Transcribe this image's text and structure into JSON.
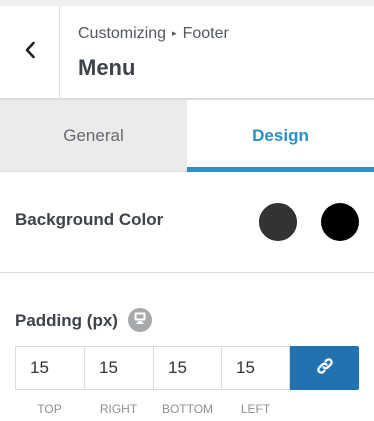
{
  "header": {
    "breadcrumb": {
      "root": "Customizing",
      "section": "Footer"
    },
    "title": "Menu",
    "back_icon": "chevron-left-icon"
  },
  "tabs": [
    {
      "label": "General",
      "active": false
    },
    {
      "label": "Design",
      "active": true
    }
  ],
  "background_color": {
    "label": "Background Color",
    "swatches": [
      {
        "name": "primary",
        "color": "#333333"
      },
      {
        "name": "hover",
        "color": "#000000"
      }
    ]
  },
  "padding": {
    "label": "Padding (px)",
    "device_icon": "desktop-icon",
    "values": {
      "top": "15",
      "right": "15",
      "bottom": "15",
      "left": "15"
    },
    "side_labels": {
      "top": "Top",
      "right": "Right",
      "bottom": "Bottom",
      "left": "Left"
    },
    "linked": true,
    "link_icon": "link-icon"
  },
  "colors": {
    "accent": "#2c8fc7",
    "link_button": "#2271b1",
    "tab_inactive_bg": "#ebebeb"
  }
}
